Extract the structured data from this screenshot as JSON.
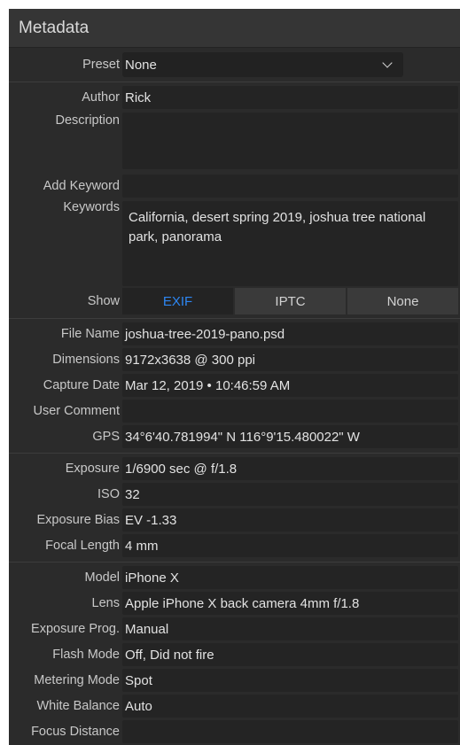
{
  "panel": {
    "title": "Metadata"
  },
  "preset": {
    "label": "Preset",
    "value": "None"
  },
  "author": {
    "label": "Author",
    "value": "Rick"
  },
  "description": {
    "label": "Description",
    "value": ""
  },
  "add_keyword": {
    "label": "Add Keyword",
    "value": ""
  },
  "keywords": {
    "label": "Keywords",
    "value": "California, desert spring 2019, joshua tree national park, panorama"
  },
  "show": {
    "label": "Show",
    "tabs": [
      "EXIF",
      "IPTC",
      "None"
    ],
    "active": "EXIF"
  },
  "file_info": [
    {
      "label": "File Name",
      "value": "joshua-tree-2019-pano.psd"
    },
    {
      "label": "Dimensions",
      "value": "9172x3638 @ 300 ppi"
    },
    {
      "label": "Capture Date",
      "value": "Mar 12, 2019 • 10:46:59 AM"
    },
    {
      "label": "User Comment",
      "value": ""
    },
    {
      "label": "GPS",
      "value": "34°6'40.781994\" N 116°9'15.480022\" W"
    }
  ],
  "exposure_info": [
    {
      "label": "Exposure",
      "value": "1/6900 sec @ f/1.8"
    },
    {
      "label": "ISO",
      "value": "32"
    },
    {
      "label": "Exposure Bias",
      "value": "EV -1.33"
    },
    {
      "label": "Focal Length",
      "value": "4 mm"
    }
  ],
  "camera_info": [
    {
      "label": "Model",
      "value": "iPhone X"
    },
    {
      "label": "Lens",
      "value": "Apple iPhone X back camera 4mm f/1.8"
    },
    {
      "label": "Exposure Prog.",
      "value": "Manual"
    },
    {
      "label": "Flash Mode",
      "value": "Off, Did not fire"
    },
    {
      "label": "Metering Mode",
      "value": "Spot"
    },
    {
      "label": "White Balance",
      "value": "Auto"
    },
    {
      "label": "Focus Distance",
      "value": ""
    }
  ],
  "colors": {
    "accent": "#2d86f2",
    "panel_bg": "#2b2b2b",
    "field_bg": "#242424"
  }
}
